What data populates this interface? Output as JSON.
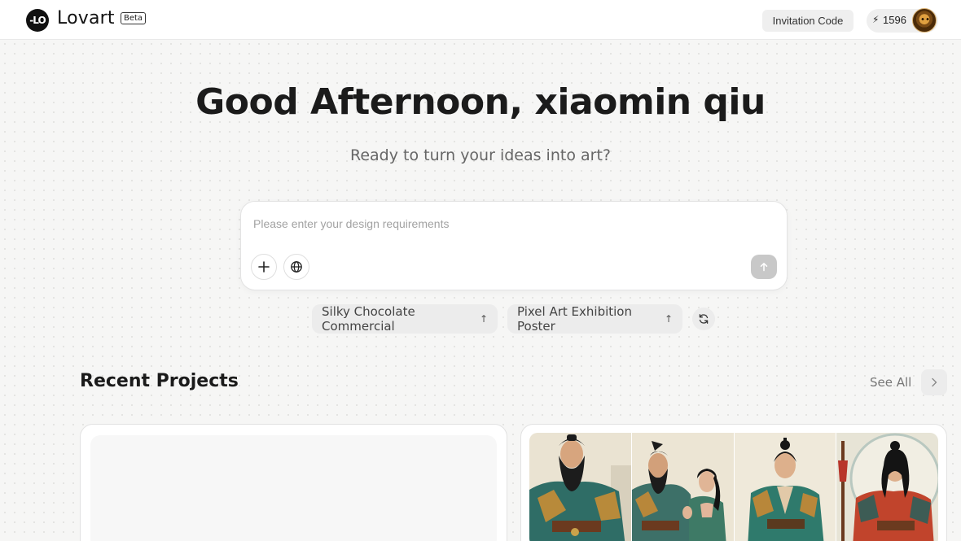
{
  "header": {
    "logo_mark": "-LO",
    "logo_text": "Lovart",
    "beta_label": "Beta",
    "invitation_label": "Invitation Code",
    "credits_icon": "bolt-icon",
    "credits_value": "1596"
  },
  "hero": {
    "greeting": "Good Afternoon, xiaomin qiu",
    "subtitle": "Ready to turn your ideas into art?"
  },
  "prompt": {
    "placeholder": "Please enter your design requirements",
    "value": "",
    "buttons": [
      "plus-icon",
      "globe-icon",
      "send-arrow-icon"
    ]
  },
  "suggestions": {
    "items": [
      {
        "label": "Silky Chocolate Commercial",
        "arrow": "↑"
      },
      {
        "label": "Pixel Art Exhibition Poster",
        "arrow": "↑"
      }
    ],
    "refresh_icon": "refresh-icon"
  },
  "recent": {
    "title": "Recent Projects",
    "see_all": "See All",
    "next_icon": "chevron-right-icon"
  },
  "colors": {
    "background": "#f6f6f5",
    "chip": "#ececec",
    "send_disabled": "#c8c8c8",
    "text_primary": "#1b1b1b"
  }
}
